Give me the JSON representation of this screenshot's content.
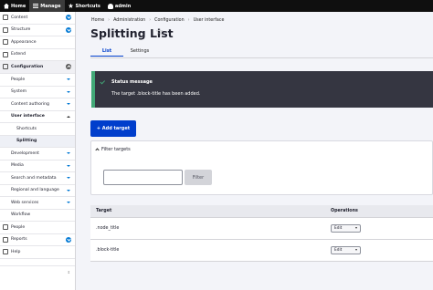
{
  "toolbar": {
    "home": "Home",
    "manage": "Manage",
    "shortcuts": "Shortcuts",
    "user": "admin"
  },
  "sidebar": {
    "content": "Content",
    "structure": "Structure",
    "appearance": "Appearance",
    "extend": "Extend",
    "configuration": "Configuration",
    "people_sub": "People",
    "system": "System",
    "content_authoring": "Content authoring",
    "user_interface": "User interface",
    "shortcuts": "Shortcuts",
    "splitting": "Splitting",
    "development": "Development",
    "media": "Media",
    "search_metadata": "Search and metadata",
    "regional_language": "Regional and language",
    "web_services": "Web services",
    "workflow": "Workflow",
    "people": "People",
    "reports": "Reports",
    "help": "Help"
  },
  "breadcrumb": {
    "items": [
      "Home",
      "Administration",
      "Configuration",
      "User interface"
    ],
    "separator": "›"
  },
  "page": {
    "title": "Splitting List",
    "star": "☆"
  },
  "tabs": {
    "list": "List",
    "settings": "Settings"
  },
  "status": {
    "title": "Status message",
    "text": "The target .block-title has been added."
  },
  "add_button": "+ Add target",
  "filter": {
    "heading": "Filter targets",
    "input_value": "",
    "button": "Filter"
  },
  "table": {
    "headers": [
      "Target",
      "Operations"
    ],
    "rows": [
      {
        "target": ".node_title",
        "operation": "Edit"
      },
      {
        "target": ".block-title",
        "operation": "Edit"
      }
    ]
  },
  "colors": {
    "accent": "#003ecc",
    "status_bg": "#353641",
    "status_ok": "#42a877",
    "badge": "#0078d4"
  }
}
